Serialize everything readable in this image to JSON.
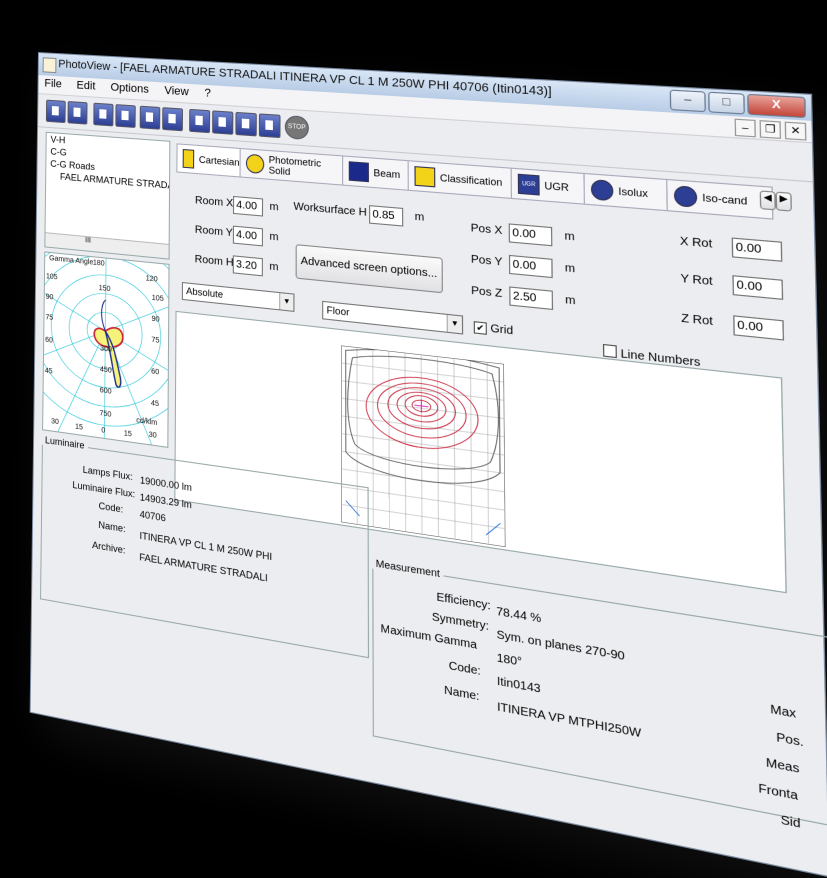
{
  "app": {
    "title": "PhotoView - [FAEL ARMATURE STRADALI ITINERA VP CL 1 M 250W PHI 40706 (Itin0143)]",
    "window_buttons": {
      "minimize": "–",
      "maximize": "□",
      "close": "X"
    },
    "mdi_buttons": {
      "minimize": "–",
      "restore": "❐",
      "close": "✕"
    }
  },
  "menu": {
    "file": "File",
    "edit": "Edit",
    "options": "Options",
    "view": "View",
    "help": "?"
  },
  "toolbar": {
    "stop_label": "STOP"
  },
  "tree": {
    "items": [
      "V-H",
      "C-G",
      "C-G Roads",
      "FAEL ARMATURE STRADALI ITI"
    ],
    "scroll_label": "III"
  },
  "polar": {
    "title": "Gamma Angle",
    "top_value": "180",
    "top_right": "120",
    "left_values": [
      "105",
      "90",
      "75",
      "60",
      "45"
    ],
    "right_values": [
      "105",
      "90",
      "75",
      "60",
      "45"
    ],
    "radial_values": [
      "150",
      "300",
      "450",
      "600",
      "750"
    ],
    "bottom_values": [
      "30",
      "15",
      "0",
      "15",
      "30"
    ],
    "unit": "cd/klm"
  },
  "tabs": [
    {
      "label": "Cartesian"
    },
    {
      "label": "Photometric Solid"
    },
    {
      "label": "Beam"
    },
    {
      "label": "Classification"
    },
    {
      "label": "UGR"
    },
    {
      "label": "Isolux"
    },
    {
      "label": "Iso-cand"
    }
  ],
  "tab_icons": {
    "ugr": "UGR"
  },
  "room": {
    "x_label": "Room X",
    "x_value": "4.00",
    "x_unit": "m",
    "y_label": "Room Y",
    "y_value": "4.00",
    "y_unit": "m",
    "h_label": "Room H",
    "h_value": "3.20",
    "h_unit": "m",
    "ws_label": "Worksurface H",
    "ws_value": "0.85",
    "ws_unit": "m"
  },
  "position": {
    "x_label": "Pos X",
    "x_value": "0.00",
    "x_unit": "m",
    "y_label": "Pos Y",
    "y_value": "0.00",
    "y_unit": "m",
    "z_label": "Pos Z",
    "z_value": "2.50",
    "z_unit": "m"
  },
  "rotation": {
    "x_label": "X Rot",
    "x_value": "0.00",
    "y_label": "Y Rot",
    "y_value": "0.00",
    "z_label": "Z Rot",
    "z_value": "0.00"
  },
  "advanced_button": "Advanced screen options...",
  "mode_select": "Absolute",
  "surface_select": "Floor",
  "grid_check": {
    "label": "Grid",
    "checked": true
  },
  "line_numbers_check": {
    "label": "Line Numbers",
    "checked": false
  },
  "luminaire": {
    "group": "Luminaire",
    "lamps_flux_label": "Lamps Flux:",
    "lamps_flux": "19000.00 lm",
    "lum_flux_label": "Luminaire Flux:",
    "lum_flux": "14903.29 lm",
    "code_label": "Code:",
    "code": "40706",
    "name_label": "Name:",
    "name": "ITINERA VP CL 1 M 250W PHI",
    "archive_label": "Archive:",
    "archive": "FAEL ARMATURE STRADALI"
  },
  "measurement": {
    "group": "Measurement",
    "efficiency_label": "Efficiency:",
    "efficiency": "78.44 %",
    "symmetry_label": "Symmetry:",
    "symmetry": "Sym. on planes 270-90",
    "max_gamma_label": "Maximum Gamma",
    "max_gamma": "180°",
    "code_label": "Code:",
    "code": "Itin0143",
    "name_label": "Name:",
    "name": "ITINERA VP MTPHI250W"
  },
  "cut_labels": [
    "Max",
    "Pos.",
    "Meas",
    "Fronta",
    "Sid"
  ],
  "colors": {
    "accent": "#2d3f94",
    "isolux_lines": "#c8233a",
    "window": "#ecedf0"
  }
}
